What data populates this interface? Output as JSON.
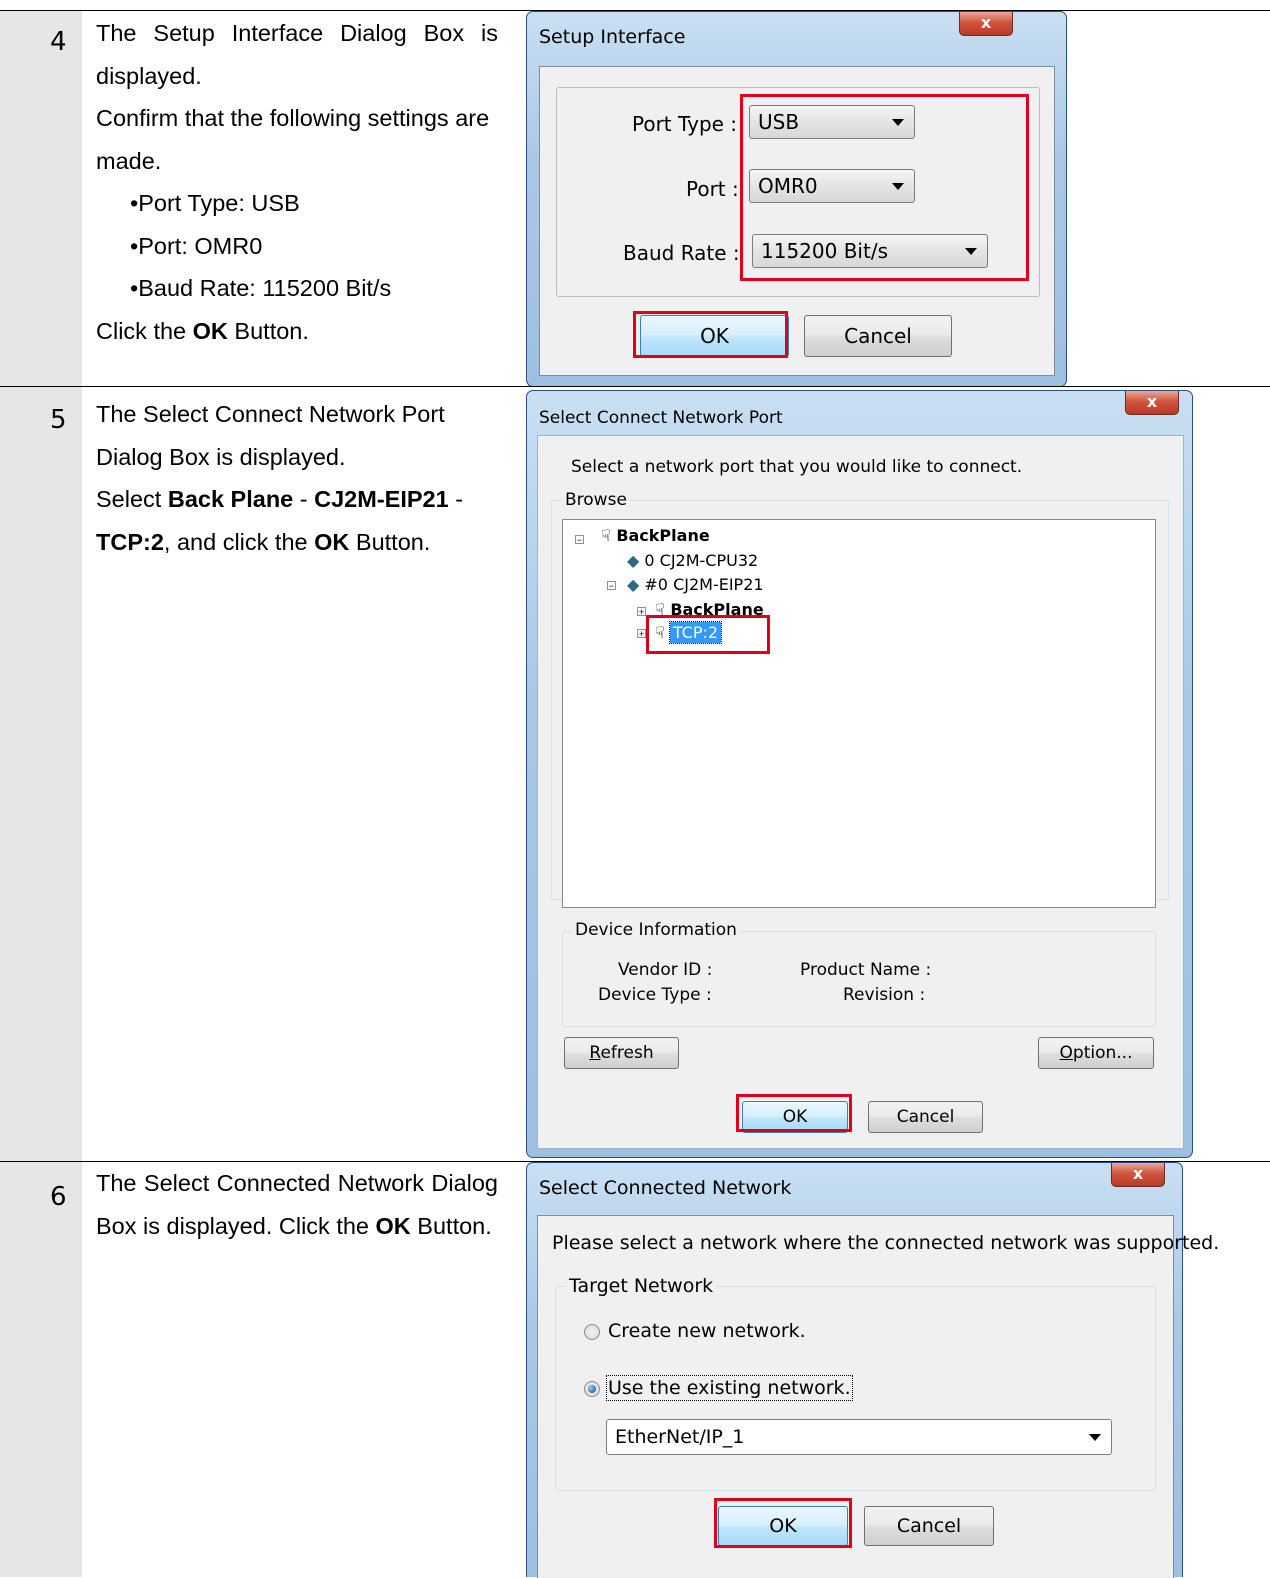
{
  "steps": [
    {
      "number": "4",
      "lines": [
        "The Setup Interface Dialog Box is displayed.",
        "Confirm that the following settings are made.",
        "•Port Type: USB",
        "•Port: OMR0",
        "•Baud Rate: 115200 Bit/s"
      ],
      "click_pre": "Click the ",
      "click_bold": "OK",
      "click_post": " Button.",
      "dialog": {
        "title": "Setup Interface",
        "close": "x",
        "port_type_label": "Port Type :",
        "port_type_value": "USB",
        "port_label": "Port :",
        "port_value": "OMR0",
        "baud_label": "Baud Rate :",
        "baud_value": "115200 Bit/s",
        "ok": "OK",
        "cancel": "Cancel"
      }
    },
    {
      "number": "5",
      "text_1": "The Select Connect Network Port Dialog Box is displayed.",
      "text_2": "Select ",
      "bold_1": "Back Plane",
      "text_3": " - ",
      "bold_2": "CJ2M-EIP21",
      "text_4": " - ",
      "bold_3": "TCP:2",
      "text_5": ", and click the ",
      "bold_4": "OK",
      "text_6": " Button.",
      "dialog": {
        "title": "Select Connect Network Port",
        "close": "x",
        "instruction": "Select a network port that you would like to connect.",
        "browse_label": "Browse",
        "tree": [
          "BackPlane",
          "0 CJ2M-CPU32",
          "#0 CJ2M-EIP21",
          "BackPlane",
          "TCP:2"
        ],
        "device_info_label": "Device Information",
        "vendor_id_label": "Vendor ID :",
        "device_type_label": "Device Type :",
        "product_name_label": "Product Name :",
        "revision_label": "Revision :",
        "refresh_accel": "R",
        "refresh_rest": "efresh",
        "option_accel": "O",
        "option_rest": "ption...",
        "ok": "OK",
        "cancel": "Cancel"
      }
    },
    {
      "number": "6",
      "text_1": "The Select Connected Network Dialog Box is displayed. Click the ",
      "bold_1": "OK",
      "text_2": " Button.",
      "dialog": {
        "title": "Select Connected Network",
        "close": "x",
        "instruction": "Please select a network where the connected network was supported.",
        "target_label": "Target Network",
        "radio_new": "Create new network.",
        "radio_existing": "Use the existing network.",
        "network_value": "EtherNet/IP_1",
        "ok": "OK",
        "cancel": "Cancel"
      }
    }
  ],
  "colors": {
    "highlight_red": "#e0001b",
    "gutter_gray": "#e6e6e6",
    "dialog_frame_blue": "#a9c8e6",
    "tree_selection_blue": "#3399ff"
  }
}
